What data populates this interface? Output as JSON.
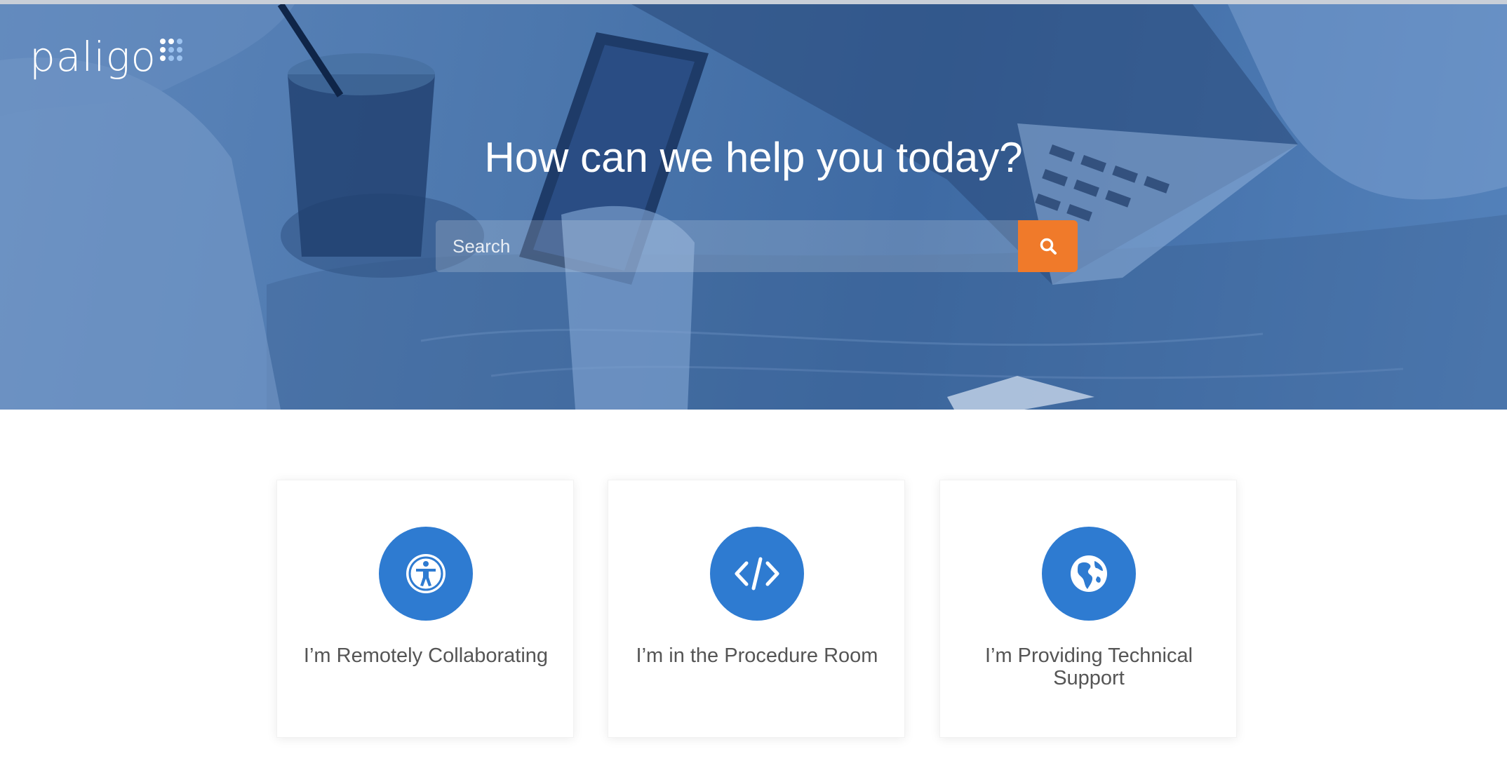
{
  "header": {
    "logo_text": "paligo"
  },
  "hero": {
    "title": "How can we help you today?"
  },
  "search": {
    "placeholder": "Search",
    "value": "",
    "button_icon": "search-icon"
  },
  "cards": [
    {
      "label": "I’m Remotely Collaborating",
      "icon": "accessibility-icon"
    },
    {
      "label": "I’m in the Procedure Room",
      "icon": "code-icon"
    },
    {
      "label": "I’m Providing Technical Support",
      "icon": "globe-icon"
    }
  ],
  "colors": {
    "hero_overlay": "#3e6aa3",
    "search_button": "#f07a2a",
    "card_icon_bg": "#2e7bd1",
    "card_text": "#555555"
  }
}
